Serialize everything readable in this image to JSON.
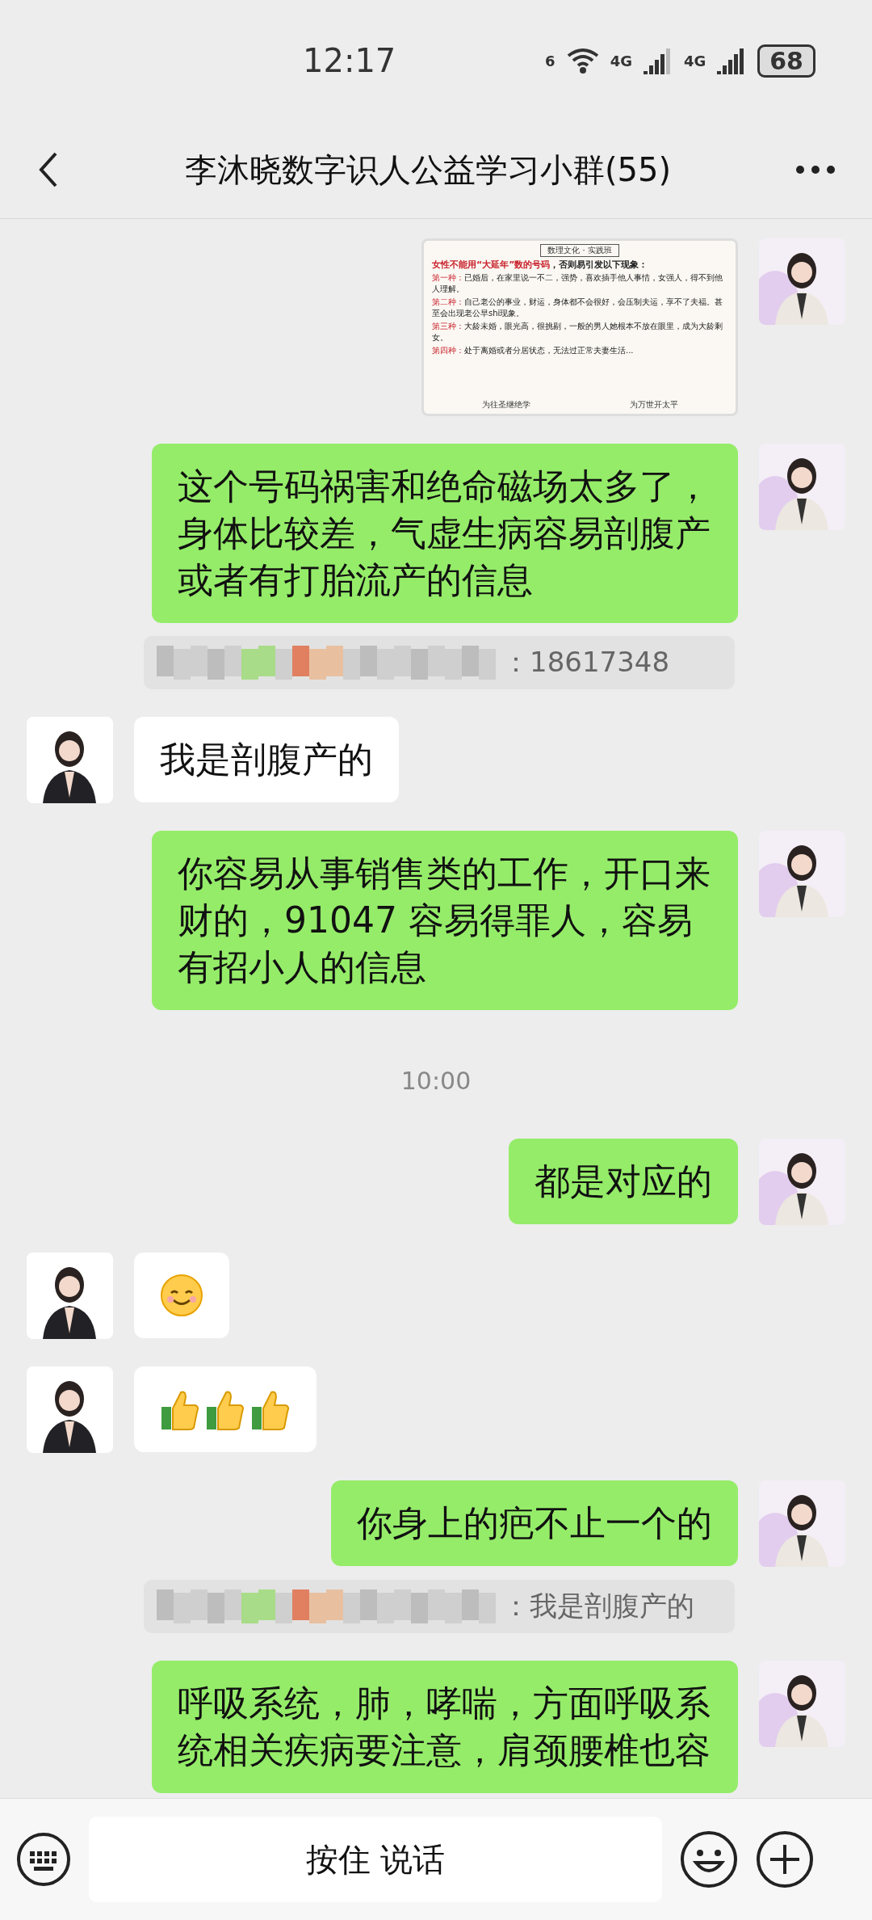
{
  "status_bar": {
    "time": "12:17",
    "wifi_label": "6",
    "networks": [
      "4G",
      "4G"
    ],
    "battery": "68"
  },
  "header": {
    "title": "李沐晓数字识人公益学习小群(55)"
  },
  "messages": [
    {
      "outgoing": true,
      "slide": {
        "banner": "数理文化 · 实践班",
        "title_highlight": "女性不能用“大延年”数的号码",
        "title_rest": "，否则易引发以下现象：",
        "items": [
          {
            "label": "第一种：",
            "text": "已婚后，在家里说一不二，强势，喜欢插手他人事情，女强人，得不到他人理解。"
          },
          {
            "label": "第二种：",
            "text": "自己老公的事业，财运，身体都不会很好，会压制夫运，享不了夫福。甚至会出现老公早shi现象。"
          },
          {
            "label": "第三种：",
            "text": "大龄未婚，眼光高，很挑剔，一般的男人她根本不放在眼里，成为大龄剩女。"
          },
          {
            "label": "第四种：",
            "text": "处于离婚或者分居状态，无法过正常夫妻生活..."
          }
        ],
        "footer": [
          "为往圣继绝学",
          "为万世开太平"
        ]
      }
    },
    {
      "kind": "text",
      "outgoing": true,
      "text": "这个号码祸害和绝命磁场太多了，身体比较差，气虚生病容易剖腹产或者有打胎流产的信息"
    },
    {
      "kind": "quote",
      "text": "：18617348"
    },
    {
      "kind": "text",
      "outgoing": false,
      "text": "我是剖腹产的"
    },
    {
      "kind": "text",
      "outgoing": true,
      "text": "你容易从事销售类的工作，开口来财的，91047 容易得罪人，容易有招小人的信息"
    },
    {
      "kind": "time",
      "text": "10:00"
    },
    {
      "kind": "text",
      "outgoing": true,
      "text": "都是对应的"
    },
    {
      "kind": "sticker",
      "outgoing": false,
      "stickers": [
        {
          "kind": "smile"
        }
      ]
    },
    {
      "kind": "sticker",
      "outgoing": false,
      "stickers": [
        {
          "kind": "thumbs"
        },
        {
          "kind": "thumbs"
        },
        {
          "kind": "thumbs"
        }
      ]
    },
    {
      "kind": "text",
      "outgoing": true,
      "text": "你身上的疤不止一个的"
    },
    {
      "kind": "quote",
      "text": "：我是剖腹产的"
    },
    {
      "kind": "text",
      "outgoing": true,
      "text": "呼吸系统，肺，哮喘，方面呼吸系统相关疾病要注意，肩颈腰椎也容"
    }
  ],
  "input_bar": {
    "voice_button": "按住 说话"
  }
}
